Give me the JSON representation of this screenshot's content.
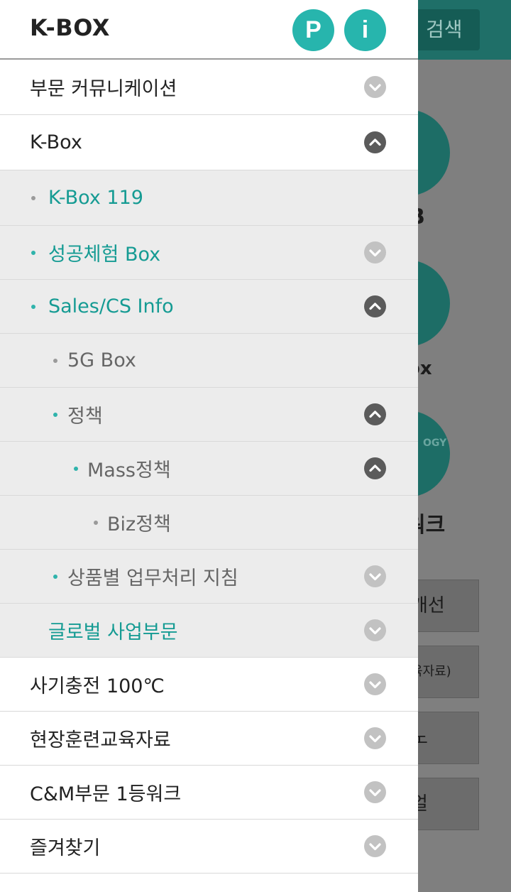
{
  "header": {
    "brand": "K-BOX",
    "p_button": "P",
    "i_button": "i"
  },
  "background": {
    "search_label": "검색",
    "label_1": "B",
    "label_2": "ox",
    "label_3": "워크",
    "circle_text": "OGY",
    "btn_1": "개선",
    "btn_2": "육자료)",
    "btn_3": "노",
    "btn_4": "얼"
  },
  "menu": [
    {
      "label": "부문 커뮤니케이션",
      "chevron": "down"
    },
    {
      "label": "K-Box",
      "chevron": "up"
    },
    {
      "label": "K-Box 119",
      "chevron": ""
    },
    {
      "label": "성공체험 Box",
      "chevron": "down"
    },
    {
      "label": "Sales/CS Info",
      "chevron": "up"
    },
    {
      "label": "5G Box",
      "chevron": ""
    },
    {
      "label": "정책",
      "chevron": "up"
    },
    {
      "label": "Mass정책",
      "chevron": "up"
    },
    {
      "label": "Biz정책",
      "chevron": ""
    },
    {
      "label": "상품별 업무처리 지침",
      "chevron": "down"
    },
    {
      "label": "글로벌 사업부문",
      "chevron": "down"
    },
    {
      "label": "사기충전 100℃",
      "chevron": "down"
    },
    {
      "label": "현장훈련교육자료",
      "chevron": "down"
    },
    {
      "label": "C&M부문 1등워크",
      "chevron": "down"
    },
    {
      "label": "즐겨찾기",
      "chevron": "down"
    },
    {
      "label": "",
      "chevron": ""
    }
  ],
  "colors": {
    "accent": "#27b5ad",
    "teal_text": "#159b93",
    "chevron_down": "#c2c2c2",
    "chevron_up": "#5b5b5b"
  }
}
